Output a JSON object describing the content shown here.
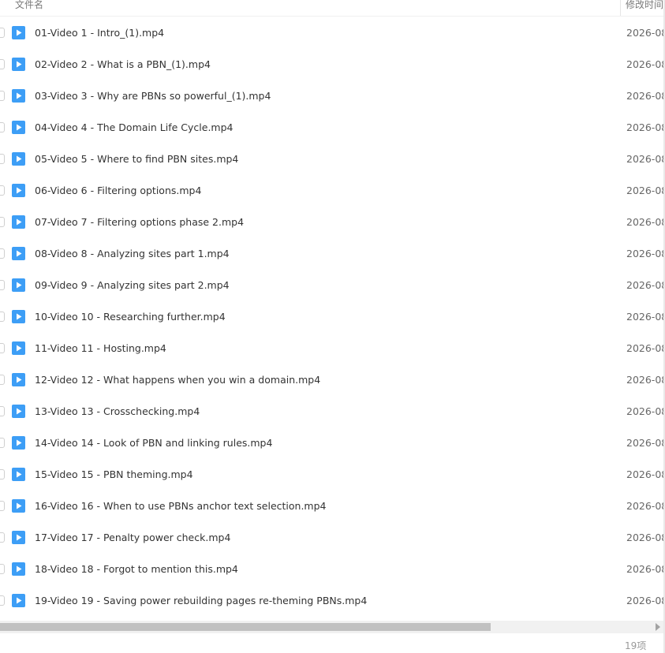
{
  "header": {
    "name_column": "文件名",
    "date_column": "修改时间"
  },
  "files": [
    {
      "name": "01-Video 1 - Intro_(1).mp4",
      "date": "2026-08"
    },
    {
      "name": "02-Video 2 - What is a PBN_(1).mp4",
      "date": "2026-08"
    },
    {
      "name": "03-Video 3 - Why are PBNs so powerful_(1).mp4",
      "date": "2026-08"
    },
    {
      "name": "04-Video 4 - The Domain Life Cycle.mp4",
      "date": "2026-08"
    },
    {
      "name": "05-Video 5 - Where to find PBN sites.mp4",
      "date": "2026-08"
    },
    {
      "name": "06-Video 6 - Filtering options.mp4",
      "date": "2026-08"
    },
    {
      "name": "07-Video 7 - Filtering options phase 2.mp4",
      "date": "2026-08"
    },
    {
      "name": "08-Video 8 - Analyzing sites part 1.mp4",
      "date": "2026-08"
    },
    {
      "name": "09-Video 9 - Analyzing sites part 2.mp4",
      "date": "2026-08"
    },
    {
      "name": "10-Video 10 - Researching further.mp4",
      "date": "2026-08"
    },
    {
      "name": "11-Video 11 - Hosting.mp4",
      "date": "2026-08"
    },
    {
      "name": "12-Video 12 - What happens when you win a domain.mp4",
      "date": "2026-08"
    },
    {
      "name": "13-Video 13 - Crosschecking.mp4",
      "date": "2026-08"
    },
    {
      "name": "14-Video 14 - Look of PBN and linking rules.mp4",
      "date": "2026-08"
    },
    {
      "name": "15-Video 15 - PBN theming.mp4",
      "date": "2026-08"
    },
    {
      "name": "16-Video 16 - When to use PBNs anchor text selection.mp4",
      "date": "2026-08"
    },
    {
      "name": "17-Video 17 - Penalty power check.mp4",
      "date": "2026-08"
    },
    {
      "name": "18-Video 18 - Forgot to mention this.mp4",
      "date": "2026-08"
    },
    {
      "name": "19-Video 19 - Saving power rebuilding pages re-theming PBNs.mp4",
      "date": "2026-08"
    }
  ],
  "file_icon": "video-file-icon",
  "colors": {
    "icon_blue": "#3d9ef6",
    "scroll_thumb": "#c1c1c1"
  },
  "scrollbar": {
    "horizontal_position": 0.0,
    "visible_fraction": 0.74
  },
  "footer": {
    "item_count": "19项"
  }
}
